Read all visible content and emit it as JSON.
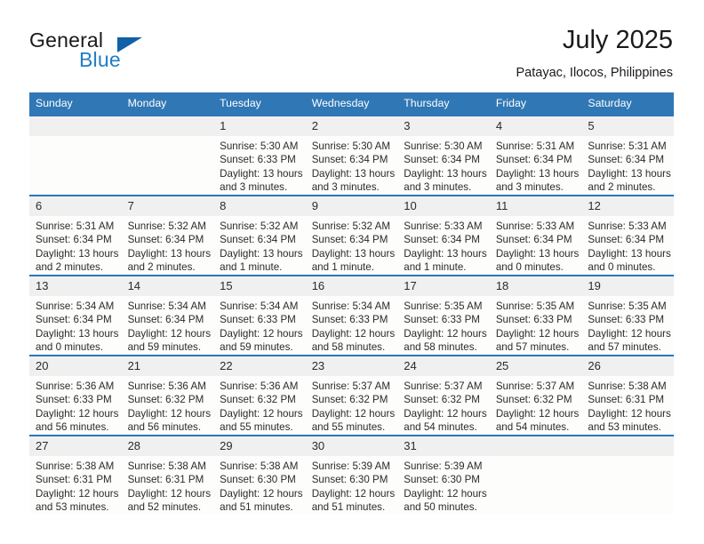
{
  "brand": {
    "name_part1": "General",
    "name_part2": "Blue",
    "triangle_icon": "brand-triangle-icon",
    "accent_color": "#1f7ec4",
    "triangle_color": "#1260a8"
  },
  "header": {
    "title": "July 2025",
    "subtitle": "Patayac, Ilocos, Philippines"
  },
  "calendar": {
    "header_background": "#3077b5",
    "header_text_color": "#ffffff",
    "daynum_background": "#f0f0f0",
    "weekday_headers": [
      "Sunday",
      "Monday",
      "Tuesday",
      "Wednesday",
      "Thursday",
      "Friday",
      "Saturday"
    ],
    "weeks": [
      [
        {
          "day": "",
          "sunrise": "",
          "sunset": "",
          "daylight_line1": "",
          "daylight_line2": ""
        },
        {
          "day": "",
          "sunrise": "",
          "sunset": "",
          "daylight_line1": "",
          "daylight_line2": ""
        },
        {
          "day": "1",
          "sunrise": "Sunrise: 5:30 AM",
          "sunset": "Sunset: 6:33 PM",
          "daylight_line1": "Daylight: 13 hours",
          "daylight_line2": "and 3 minutes."
        },
        {
          "day": "2",
          "sunrise": "Sunrise: 5:30 AM",
          "sunset": "Sunset: 6:34 PM",
          "daylight_line1": "Daylight: 13 hours",
          "daylight_line2": "and 3 minutes."
        },
        {
          "day": "3",
          "sunrise": "Sunrise: 5:30 AM",
          "sunset": "Sunset: 6:34 PM",
          "daylight_line1": "Daylight: 13 hours",
          "daylight_line2": "and 3 minutes."
        },
        {
          "day": "4",
          "sunrise": "Sunrise: 5:31 AM",
          "sunset": "Sunset: 6:34 PM",
          "daylight_line1": "Daylight: 13 hours",
          "daylight_line2": "and 3 minutes."
        },
        {
          "day": "5",
          "sunrise": "Sunrise: 5:31 AM",
          "sunset": "Sunset: 6:34 PM",
          "daylight_line1": "Daylight: 13 hours",
          "daylight_line2": "and 2 minutes."
        }
      ],
      [
        {
          "day": "6",
          "sunrise": "Sunrise: 5:31 AM",
          "sunset": "Sunset: 6:34 PM",
          "daylight_line1": "Daylight: 13 hours",
          "daylight_line2": "and 2 minutes."
        },
        {
          "day": "7",
          "sunrise": "Sunrise: 5:32 AM",
          "sunset": "Sunset: 6:34 PM",
          "daylight_line1": "Daylight: 13 hours",
          "daylight_line2": "and 2 minutes."
        },
        {
          "day": "8",
          "sunrise": "Sunrise: 5:32 AM",
          "sunset": "Sunset: 6:34 PM",
          "daylight_line1": "Daylight: 13 hours",
          "daylight_line2": "and 1 minute."
        },
        {
          "day": "9",
          "sunrise": "Sunrise: 5:32 AM",
          "sunset": "Sunset: 6:34 PM",
          "daylight_line1": "Daylight: 13 hours",
          "daylight_line2": "and 1 minute."
        },
        {
          "day": "10",
          "sunrise": "Sunrise: 5:33 AM",
          "sunset": "Sunset: 6:34 PM",
          "daylight_line1": "Daylight: 13 hours",
          "daylight_line2": "and 1 minute."
        },
        {
          "day": "11",
          "sunrise": "Sunrise: 5:33 AM",
          "sunset": "Sunset: 6:34 PM",
          "daylight_line1": "Daylight: 13 hours",
          "daylight_line2": "and 0 minutes."
        },
        {
          "day": "12",
          "sunrise": "Sunrise: 5:33 AM",
          "sunset": "Sunset: 6:34 PM",
          "daylight_line1": "Daylight: 13 hours",
          "daylight_line2": "and 0 minutes."
        }
      ],
      [
        {
          "day": "13",
          "sunrise": "Sunrise: 5:34 AM",
          "sunset": "Sunset: 6:34 PM",
          "daylight_line1": "Daylight: 13 hours",
          "daylight_line2": "and 0 minutes."
        },
        {
          "day": "14",
          "sunrise": "Sunrise: 5:34 AM",
          "sunset": "Sunset: 6:34 PM",
          "daylight_line1": "Daylight: 12 hours",
          "daylight_line2": "and 59 minutes."
        },
        {
          "day": "15",
          "sunrise": "Sunrise: 5:34 AM",
          "sunset": "Sunset: 6:33 PM",
          "daylight_line1": "Daylight: 12 hours",
          "daylight_line2": "and 59 minutes."
        },
        {
          "day": "16",
          "sunrise": "Sunrise: 5:34 AM",
          "sunset": "Sunset: 6:33 PM",
          "daylight_line1": "Daylight: 12 hours",
          "daylight_line2": "and 58 minutes."
        },
        {
          "day": "17",
          "sunrise": "Sunrise: 5:35 AM",
          "sunset": "Sunset: 6:33 PM",
          "daylight_line1": "Daylight: 12 hours",
          "daylight_line2": "and 58 minutes."
        },
        {
          "day": "18",
          "sunrise": "Sunrise: 5:35 AM",
          "sunset": "Sunset: 6:33 PM",
          "daylight_line1": "Daylight: 12 hours",
          "daylight_line2": "and 57 minutes."
        },
        {
          "day": "19",
          "sunrise": "Sunrise: 5:35 AM",
          "sunset": "Sunset: 6:33 PM",
          "daylight_line1": "Daylight: 12 hours",
          "daylight_line2": "and 57 minutes."
        }
      ],
      [
        {
          "day": "20",
          "sunrise": "Sunrise: 5:36 AM",
          "sunset": "Sunset: 6:33 PM",
          "daylight_line1": "Daylight: 12 hours",
          "daylight_line2": "and 56 minutes."
        },
        {
          "day": "21",
          "sunrise": "Sunrise: 5:36 AM",
          "sunset": "Sunset: 6:32 PM",
          "daylight_line1": "Daylight: 12 hours",
          "daylight_line2": "and 56 minutes."
        },
        {
          "day": "22",
          "sunrise": "Sunrise: 5:36 AM",
          "sunset": "Sunset: 6:32 PM",
          "daylight_line1": "Daylight: 12 hours",
          "daylight_line2": "and 55 minutes."
        },
        {
          "day": "23",
          "sunrise": "Sunrise: 5:37 AM",
          "sunset": "Sunset: 6:32 PM",
          "daylight_line1": "Daylight: 12 hours",
          "daylight_line2": "and 55 minutes."
        },
        {
          "day": "24",
          "sunrise": "Sunrise: 5:37 AM",
          "sunset": "Sunset: 6:32 PM",
          "daylight_line1": "Daylight: 12 hours",
          "daylight_line2": "and 54 minutes."
        },
        {
          "day": "25",
          "sunrise": "Sunrise: 5:37 AM",
          "sunset": "Sunset: 6:32 PM",
          "daylight_line1": "Daylight: 12 hours",
          "daylight_line2": "and 54 minutes."
        },
        {
          "day": "26",
          "sunrise": "Sunrise: 5:38 AM",
          "sunset": "Sunset: 6:31 PM",
          "daylight_line1": "Daylight: 12 hours",
          "daylight_line2": "and 53 minutes."
        }
      ],
      [
        {
          "day": "27",
          "sunrise": "Sunrise: 5:38 AM",
          "sunset": "Sunset: 6:31 PM",
          "daylight_line1": "Daylight: 12 hours",
          "daylight_line2": "and 53 minutes."
        },
        {
          "day": "28",
          "sunrise": "Sunrise: 5:38 AM",
          "sunset": "Sunset: 6:31 PM",
          "daylight_line1": "Daylight: 12 hours",
          "daylight_line2": "and 52 minutes."
        },
        {
          "day": "29",
          "sunrise": "Sunrise: 5:38 AM",
          "sunset": "Sunset: 6:30 PM",
          "daylight_line1": "Daylight: 12 hours",
          "daylight_line2": "and 51 minutes."
        },
        {
          "day": "30",
          "sunrise": "Sunrise: 5:39 AM",
          "sunset": "Sunset: 6:30 PM",
          "daylight_line1": "Daylight: 12 hours",
          "daylight_line2": "and 51 minutes."
        },
        {
          "day": "31",
          "sunrise": "Sunrise: 5:39 AM",
          "sunset": "Sunset: 6:30 PM",
          "daylight_line1": "Daylight: 12 hours",
          "daylight_line2": "and 50 minutes."
        },
        {
          "day": "",
          "sunrise": "",
          "sunset": "",
          "daylight_line1": "",
          "daylight_line2": ""
        },
        {
          "day": "",
          "sunrise": "",
          "sunset": "",
          "daylight_line1": "",
          "daylight_line2": ""
        }
      ]
    ]
  }
}
